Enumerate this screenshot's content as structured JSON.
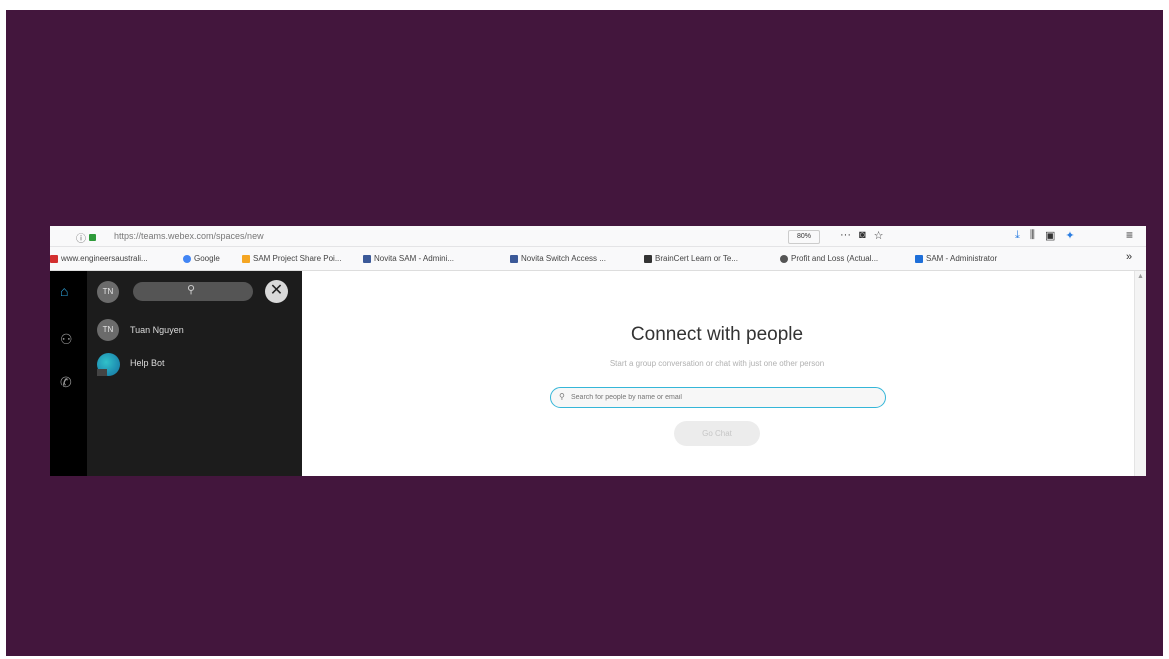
{
  "colors": {
    "slide_bg": "#43163d",
    "rail_bg": "#000000",
    "panel_bg": "#1c1c1c",
    "accent_search_border": "#35b6d8",
    "home_icon": "#2fa7e0"
  },
  "browser": {
    "url": "https://teams.webex.com/spaces/new",
    "zoom": "80%",
    "menu_dots": "···",
    "bookmarks": [
      {
        "label": "www.engineersaustrali...",
        "icon": "red-square-icon",
        "color": "#d32f2f"
      },
      {
        "label": "Google",
        "icon": "google-icon",
        "color": "#4285f4"
      },
      {
        "label": "SAM Project Share Poi...",
        "icon": "folder-icon",
        "color": "#f5a623"
      },
      {
        "label": "Novita SAM - Admini...",
        "icon": "joomla-icon",
        "color": "#3b5998"
      },
      {
        "label": "Novita Switch Access ...",
        "icon": "joomla-icon",
        "color": "#3b5998"
      },
      {
        "label": "BrainCert Learn or Te...",
        "icon": "braincert-icon",
        "color": "#333333"
      },
      {
        "label": "Profit and Loss (Actual...",
        "icon": "globe-icon",
        "color": "#555555"
      },
      {
        "label": "SAM - Administrator",
        "icon": "doc-icon",
        "color": "#1e6fd9"
      }
    ],
    "more_bookmarks": "»"
  },
  "sidebar": {
    "avatar_initials": "TN",
    "contacts": [
      {
        "initials": "TN",
        "name": "Tuan Nguyen"
      },
      {
        "initials": "",
        "name": "Help Bot"
      }
    ]
  },
  "main": {
    "title": "Connect with people",
    "subtitle": "Start a group conversation or chat with just one other person",
    "search_placeholder": "Search for people by name or email",
    "go_chat": "Go Chat"
  }
}
